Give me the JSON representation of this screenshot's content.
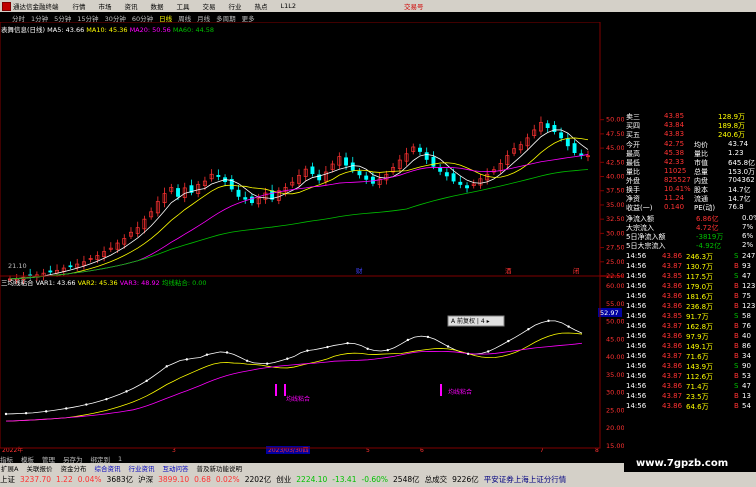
{
  "app": {
    "title": "通达信金融终端",
    "menu": [
      "行情",
      "市场",
      "资讯",
      "数据",
      "工具",
      "交易",
      "行业",
      "热点",
      "L1L2"
    ],
    "right_title": "交易号"
  },
  "periods": {
    "items": [
      "分时",
      "1分钟",
      "5分钟",
      "15分钟",
      "30分钟",
      "60分钟",
      "日线",
      "周线",
      "月线",
      "多周期",
      "更多"
    ],
    "active": "日线"
  },
  "ma_legend": {
    "name": "表舞信息(日线)",
    "ma5": "MA5: 43.66",
    "ma10": "MA10: 45.36",
    "ma20": "MA20: 50.56",
    "ma60": "MA60: 44.58"
  },
  "price_axis": [
    "50.00",
    "47.50",
    "45.00",
    "42.50",
    "40.00",
    "37.50",
    "35.00",
    "32.50",
    "30.00",
    "27.50",
    "25.00",
    "22.50"
  ],
  "low_label": "21.10",
  "indicator": {
    "name": "三均线粘合",
    "var1": "VAR1: 43.66",
    "var2": "VAR2: 45.36",
    "var3": "VAR3: 48.92",
    "var4": "均线粘合: 0.00",
    "axis": [
      "60.00",
      "55.00",
      "50.00",
      "45.00",
      "40.00",
      "35.00",
      "30.00",
      "25.00",
      "20.00",
      "15.00"
    ],
    "marker_label": "均线粘合",
    "tooltip": "A 前复权 | 4 ▸",
    "cursor_value": "52.97"
  },
  "date_axis": {
    "labels": [
      "2022年",
      "3",
      "2023/03/30四",
      "5",
      "6",
      "7",
      "8"
    ]
  },
  "event_markers": [
    "财",
    "酒",
    "闭"
  ],
  "quote": {
    "levels": [
      {
        "label": "卖三",
        "price": "43.85",
        "vol": "128.9万"
      },
      {
        "label": "买四",
        "price": "43.84",
        "vol": "189.8万"
      },
      {
        "label": "买五",
        "price": "43.83",
        "vol": "240.6万"
      }
    ],
    "stats": [
      {
        "k1": "今开",
        "v1": "42.75",
        "k2": "均价",
        "v2": "43.74"
      },
      {
        "k1": "最高",
        "v1": "45.38",
        "k2": "量比",
        "v2": "1.23"
      },
      {
        "k1": "最低",
        "v1": "42.33",
        "k2": "市值",
        "v2": "645.8亿"
      },
      {
        "k1": "量比",
        "v1": "11025",
        "k2": "总量",
        "v2": "153.0万"
      },
      {
        "k1": "外盘",
        "v1": "825527",
        "k2": "内盘",
        "v2": "704362"
      },
      {
        "k1": "换手",
        "v1": "10.41%",
        "k2": "股本",
        "v2": "14.7亿"
      },
      {
        "k1": "净资",
        "v1": "11.24",
        "k2": "流通",
        "v2": "14.7亿"
      },
      {
        "k1": "收益(一)",
        "v1": "0.140",
        "k2": "PE(动)",
        "v2": "76.8"
      }
    ],
    "flows": [
      {
        "label": "净流入额",
        "value": "6.86亿",
        "pct": "0.0%"
      },
      {
        "label": "大宗流入",
        "value": "4.72亿",
        "pct": "7%"
      },
      {
        "label": "5日净流入额",
        "value": "-3819万",
        "pct": "6%"
      },
      {
        "label": "5日大宗流入",
        "value": "-4.92亿",
        "pct": "2%"
      }
    ],
    "ticks": [
      {
        "time": "14:56",
        "price": "43.86",
        "vol": "246.3万",
        "dir": "S",
        "n": "247"
      },
      {
        "time": "14:56",
        "price": "43.87",
        "vol": "130.7万",
        "dir": "B",
        "n": "93"
      },
      {
        "time": "14:56",
        "price": "43.85",
        "vol": "117.5万",
        "dir": "S",
        "n": "47"
      },
      {
        "time": "14:56",
        "price": "43.86",
        "vol": "179.0万",
        "dir": "B",
        "n": "123"
      },
      {
        "time": "14:56",
        "price": "43.86",
        "vol": "181.6万",
        "dir": "B",
        "n": "75"
      },
      {
        "time": "14:56",
        "price": "43.86",
        "vol": "236.8万",
        "dir": "B",
        "n": "123"
      },
      {
        "time": "14:56",
        "price": "43.85",
        "vol": "91.7万",
        "dir": "S",
        "n": "58"
      },
      {
        "time": "14:56",
        "price": "43.87",
        "vol": "162.8万",
        "dir": "B",
        "n": "76"
      },
      {
        "time": "14:56",
        "price": "43.86",
        "vol": "97.9万",
        "dir": "B",
        "n": "40"
      },
      {
        "time": "14:56",
        "price": "43.86",
        "vol": "149.1万",
        "dir": "B",
        "n": "86"
      },
      {
        "time": "14:56",
        "price": "43.87",
        "vol": "71.6万",
        "dir": "B",
        "n": "34"
      },
      {
        "time": "14:56",
        "price": "43.86",
        "vol": "143.9万",
        "dir": "S",
        "n": "90"
      },
      {
        "time": "14:56",
        "price": "43.87",
        "vol": "112.6万",
        "dir": "B",
        "n": "53"
      },
      {
        "time": "14:56",
        "price": "43.86",
        "vol": "71.4万",
        "dir": "S",
        "n": "47"
      },
      {
        "time": "14:56",
        "price": "43.87",
        "vol": "23.5万",
        "dir": "B",
        "n": "13"
      },
      {
        "time": "14:56",
        "price": "43.86",
        "vol": "64.6万",
        "dir": "B",
        "n": "54"
      }
    ]
  },
  "toolbar": [
    "指标",
    "模板",
    "管理",
    "另存为",
    "绑定到",
    "1"
  ],
  "tabs": [
    "扩展A",
    "关联报价",
    "资金分布",
    "综合资讯",
    "行业资讯",
    "互动问答",
    "普及新功能说明"
  ],
  "status": {
    "sh_label": "上证",
    "sh_val": "3237.70",
    "sh_chg": "1.22",
    "sh_pct": "0.04%",
    "sh_amt": "3683亿",
    "hs_label": "沪深",
    "hs_val": "3899.10",
    "hs_chg": "0.68",
    "hs_pct": "0.02%",
    "hs_amt": "2202亿",
    "cy_label": "创业",
    "cy_val": "2224.10",
    "cy_chg": "-13.41",
    "cy_pct": "-0.60%",
    "cy_amt": "2548亿",
    "total_label": "总成交",
    "total_amt": "9226亿",
    "broker": "平安证券上海上证分行情"
  },
  "watermark": "www.7gpzb.com",
  "chart_data": {
    "type": "candlestick",
    "ylim": [
      22.5,
      51
    ],
    "ohlc_close_approx": [
      22.0,
      22.1,
      22.3,
      22.5,
      22.7,
      23.0,
      23.2,
      23.5,
      23.9,
      24.2,
      24.6,
      25.0,
      25.6,
      26.1,
      26.8,
      27.4,
      28.3,
      29.1,
      30.2,
      31.0,
      32.5,
      33.8,
      35.6,
      37.0,
      38.1,
      36.5,
      38.0,
      37.2,
      38.6,
      39.2,
      40.4,
      40.0,
      39.1,
      37.8,
      36.5,
      36.0,
      35.4,
      36.2,
      37.1,
      36.0,
      37.5,
      38.1,
      39.0,
      40.2,
      41.3,
      40.5,
      39.4,
      40.8,
      42.2,
      43.5,
      42.0,
      41.1,
      40.3,
      39.5,
      38.8,
      39.6,
      40.4,
      41.6,
      42.9,
      44.0,
      45.2,
      44.4,
      43.0,
      41.8,
      40.9,
      40.1,
      39.2,
      38.6,
      38.0,
      38.7,
      39.6,
      40.4,
      41.2,
      42.3,
      43.7,
      44.9,
      45.6,
      46.8,
      48.2,
      49.5,
      48.6,
      47.9,
      46.8,
      45.4,
      44.2,
      43.7,
      43.66
    ]
  }
}
